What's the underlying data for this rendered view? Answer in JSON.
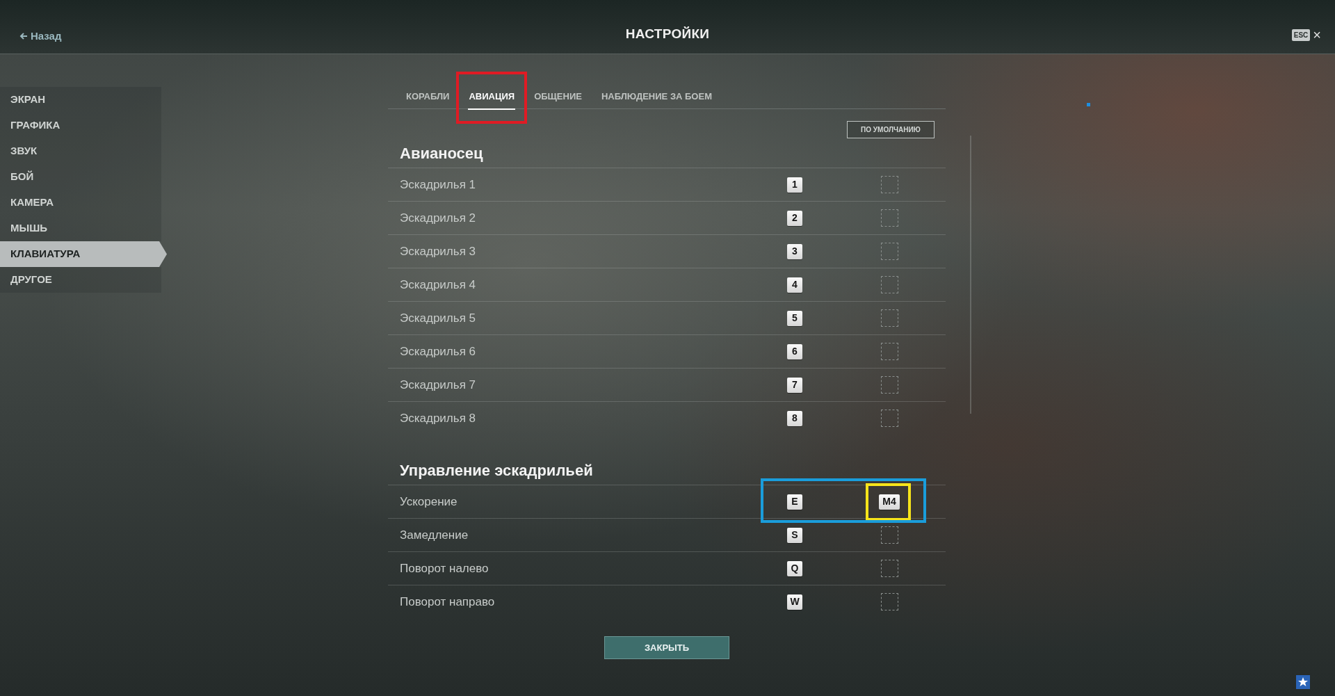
{
  "header": {
    "back": "Назад",
    "title": "НАСТРОЙКИ",
    "esc_key": "ESC",
    "close": "×"
  },
  "sidebar": {
    "items": [
      {
        "label": "ЭКРАН",
        "selected": false
      },
      {
        "label": "ГРАФИКА",
        "selected": false
      },
      {
        "label": "ЗВУК",
        "selected": false
      },
      {
        "label": "БОЙ",
        "selected": false
      },
      {
        "label": "КАМЕРА",
        "selected": false
      },
      {
        "label": "МЫШЬ",
        "selected": false
      },
      {
        "label": "КЛАВИАТУРА",
        "selected": true
      },
      {
        "label": "ДРУГОЕ",
        "selected": false
      }
    ]
  },
  "tabs": [
    {
      "label": "КОРАБЛИ",
      "selected": false
    },
    {
      "label": "АВИАЦИЯ",
      "selected": true,
      "highlight": {
        "color": "#e01b24"
      }
    },
    {
      "label": "ОБЩЕНИЕ",
      "selected": false
    },
    {
      "label": "НАБЛЮДЕНИЕ ЗА БОЕМ",
      "selected": false
    }
  ],
  "default_button": "ПО УМОЛЧАНИЮ",
  "sections": [
    {
      "title": "Авианосец",
      "rows": [
        {
          "label": "Эскадрилья 1",
          "key1": "1"
        },
        {
          "label": "Эскадрилья 2",
          "key1": "2"
        },
        {
          "label": "Эскадрилья 3",
          "key1": "3"
        },
        {
          "label": "Эскадрилья 4",
          "key1": "4"
        },
        {
          "label": "Эскадрилья 5",
          "key1": "5"
        },
        {
          "label": "Эскадрилья 6",
          "key1": "6"
        },
        {
          "label": "Эскадрилья 7",
          "key1": "7"
        },
        {
          "label": "Эскадрилья 8",
          "key1": "8"
        }
      ]
    },
    {
      "title": "Управление эскадрильей",
      "rows": [
        {
          "label": "Ускорение",
          "key1": "E",
          "key2": "M4",
          "highlight": {
            "color": "#1a9ddb"
          },
          "key2_highlight": {
            "color": "#f7e41a"
          }
        },
        {
          "label": "Замедление",
          "key1": "S"
        },
        {
          "label": "Поворот налево",
          "key1": "Q"
        },
        {
          "label": "Поворот направо",
          "key1": "W"
        }
      ]
    }
  ],
  "close_button": "ЗАКРЫТЬ"
}
